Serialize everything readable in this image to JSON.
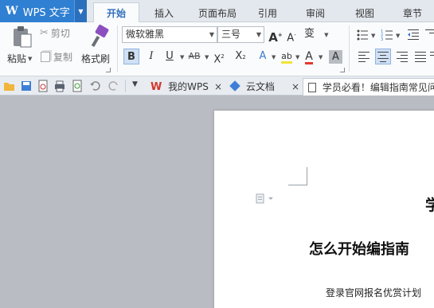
{
  "app": {
    "logo": "W",
    "name": "WPS 文字"
  },
  "menu_tabs": [
    {
      "label": "开始",
      "active": true
    },
    {
      "label": "插入"
    },
    {
      "label": "页面布局"
    },
    {
      "label": "引用"
    },
    {
      "label": "审阅"
    },
    {
      "label": "视图"
    },
    {
      "label": "章节"
    }
  ],
  "ribbon": {
    "paste_label": "粘贴",
    "cut_label": "剪切",
    "copy_label": "复制",
    "format_painter_label": "格式刷",
    "font_name": "微软雅黑",
    "font_size": "三号",
    "bold": "B",
    "italic": "I",
    "underline": "U",
    "strike": "AB",
    "superscript": "X",
    "subscript": "X",
    "grow_font": "A",
    "shrink_font": "A",
    "pinyin": "变",
    "highlight": "ab",
    "font_color": "A",
    "char_shading": "A"
  },
  "quick_access": [
    "open-icon",
    "save-icon",
    "export-pdf-icon",
    "print-icon",
    "print-preview-icon",
    "undo-icon",
    "redo-icon"
  ],
  "doc_tabs": [
    {
      "label": "我的WPS"
    },
    {
      "label": "云文档"
    },
    {
      "label": "学员必看！编辑指南常见问"
    }
  ],
  "document": {
    "heading_fragment": "学",
    "title": "怎么开始编指南",
    "body_line": "登录官网报名优赏计划"
  },
  "colors": {
    "accent": "#2f7fd2",
    "tab_active_text": "#2f6fbd",
    "workspace": "#b9bcc2"
  }
}
